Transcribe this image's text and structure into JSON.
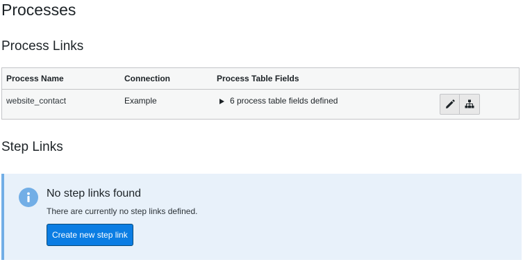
{
  "page": {
    "title": "Processes"
  },
  "process_links": {
    "title": "Process Links",
    "columns": {
      "name": "Process Name",
      "connection": "Connection",
      "fields": "Process Table Fields"
    },
    "rows": [
      {
        "name": "website_contact",
        "connection": "Example",
        "fields_summary": "6 process table fields defined",
        "actions": [
          {
            "icon": "pencil-icon",
            "label": "Edit"
          },
          {
            "icon": "sitemap-icon",
            "label": "Structure"
          }
        ]
      }
    ]
  },
  "step_links": {
    "title": "Step Links",
    "notice": {
      "icon": "info-icon",
      "title": "No step links found",
      "text": "There are currently no step links defined.",
      "button_label": "Create new step link"
    }
  },
  "colors": {
    "notice_background": "#e8f1fa",
    "notice_accent": "#72aee6",
    "primary_button": "#0b7de3",
    "table_background": "#f6f7f7"
  }
}
